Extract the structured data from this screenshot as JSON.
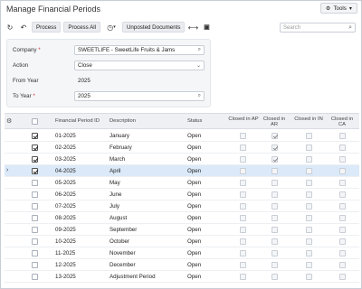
{
  "page_title": "Manage Financial Periods",
  "tools_label": "Tools",
  "toolbar": {
    "process_label": "Process",
    "process_all_label": "Process All",
    "unposted_label": "Unposted Documents"
  },
  "search_placeholder": "Search",
  "form": {
    "company": {
      "label": "Company",
      "value": "SWEETLIFE - SweetLife Fruits & Jams"
    },
    "action": {
      "label": "Action",
      "value": "Close"
    },
    "from_year": {
      "label": "From Year",
      "value": "2025"
    },
    "to_year": {
      "label": "To Year",
      "value": "2025"
    }
  },
  "columns": {
    "period_id": "Financial Period ID",
    "description": "Description",
    "status": "Status",
    "closed_ap": "Closed in AP",
    "closed_ar": "Closed in AR",
    "closed_in": "Closed in IN",
    "closed_ca": "Closed in CA"
  },
  "rows": [
    {
      "selected": true,
      "period": "01-2025",
      "description": "January",
      "status": "Open",
      "ap": false,
      "ar": true,
      "in": false,
      "ca": false,
      "current": false
    },
    {
      "selected": true,
      "period": "02-2025",
      "description": "February",
      "status": "Open",
      "ap": false,
      "ar": true,
      "in": false,
      "ca": false,
      "current": false
    },
    {
      "selected": true,
      "period": "03-2025",
      "description": "March",
      "status": "Open",
      "ap": false,
      "ar": true,
      "in": false,
      "ca": false,
      "current": false
    },
    {
      "selected": true,
      "period": "04-2025",
      "description": "April",
      "status": "Open",
      "ap": false,
      "ar": false,
      "in": false,
      "ca": false,
      "current": true
    },
    {
      "selected": false,
      "period": "05-2025",
      "description": "May",
      "status": "Open",
      "ap": false,
      "ar": false,
      "in": false,
      "ca": false,
      "current": false
    },
    {
      "selected": false,
      "period": "06-2025",
      "description": "June",
      "status": "Open",
      "ap": false,
      "ar": false,
      "in": false,
      "ca": false,
      "current": false
    },
    {
      "selected": false,
      "period": "07-2025",
      "description": "July",
      "status": "Open",
      "ap": false,
      "ar": false,
      "in": false,
      "ca": false,
      "current": false
    },
    {
      "selected": false,
      "period": "08-2025",
      "description": "August",
      "status": "Open",
      "ap": false,
      "ar": false,
      "in": false,
      "ca": false,
      "current": false
    },
    {
      "selected": false,
      "period": "09-2025",
      "description": "September",
      "status": "Open",
      "ap": false,
      "ar": false,
      "in": false,
      "ca": false,
      "current": false
    },
    {
      "selected": false,
      "period": "10-2025",
      "description": "October",
      "status": "Open",
      "ap": false,
      "ar": false,
      "in": false,
      "ca": false,
      "current": false
    },
    {
      "selected": false,
      "period": "11-2025",
      "description": "November",
      "status": "Open",
      "ap": false,
      "ar": false,
      "in": false,
      "ca": false,
      "current": false
    },
    {
      "selected": false,
      "period": "12-2025",
      "description": "December",
      "status": "Open",
      "ap": false,
      "ar": false,
      "in": false,
      "ca": false,
      "current": false
    },
    {
      "selected": false,
      "period": "13-2025",
      "description": "Adjustment Period",
      "status": "Open",
      "ap": false,
      "ar": false,
      "in": false,
      "ca": false,
      "current": false
    }
  ]
}
